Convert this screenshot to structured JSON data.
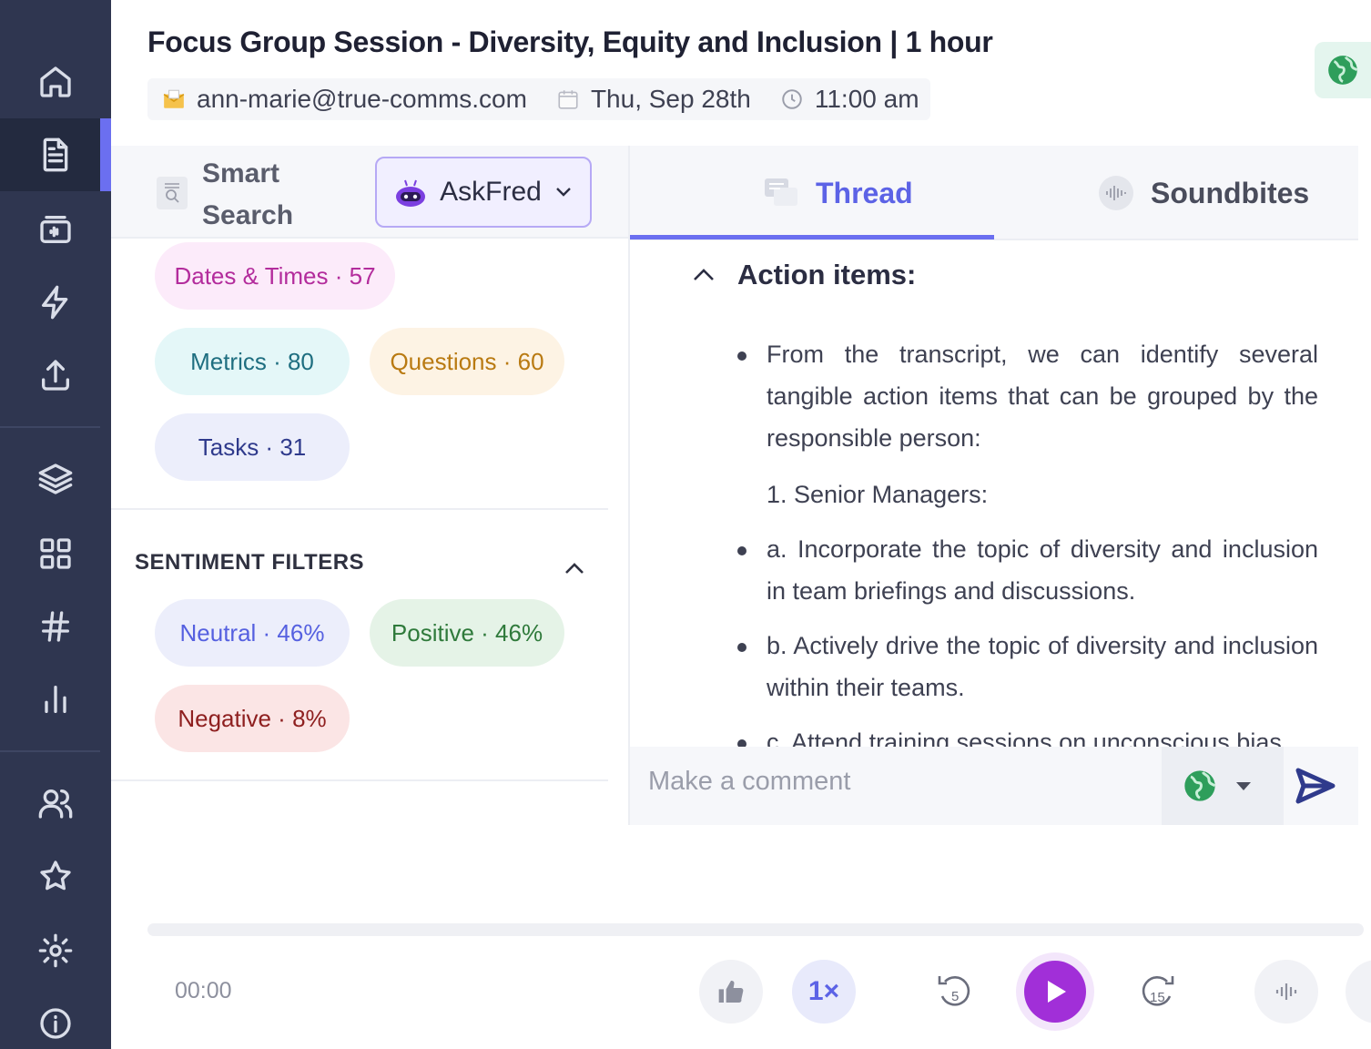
{
  "sidebar": {
    "items": [
      "home",
      "documents",
      "recordings",
      "automations",
      "upload",
      "layers",
      "apps",
      "topics",
      "analytics",
      "people",
      "favorites",
      "settings",
      "info"
    ],
    "active": "documents"
  },
  "header": {
    "title": "Focus Group Session - Diversity, Equity and Inclusion | 1 hour",
    "email": "ann-marie@true-comms.com",
    "date": "Thu, Sep 28th",
    "time": "11:00 am"
  },
  "search": {
    "label": "Smart Search",
    "askfred_label": "AskFred"
  },
  "topic_chips": [
    {
      "label": "Dates & Times · 57"
    },
    {
      "label": "Metrics · 80"
    },
    {
      "label": "Questions · 60"
    },
    {
      "label": "Tasks · 31"
    }
  ],
  "sentiment": {
    "title": "SENTIMENT FILTERS",
    "chips": [
      {
        "label": "Neutral · 46%"
      },
      {
        "label": "Positive · 46%"
      },
      {
        "label": "Negative · 8%"
      }
    ]
  },
  "tabs": [
    {
      "label": "Thread",
      "active": true
    },
    {
      "label": "Soundbites",
      "active": false
    }
  ],
  "thread": {
    "heading": "Action items:",
    "p1": "From the transcript, we can identify several tangible action items that can be grouped by the responsible person:",
    "p2": "1. Senior Managers:",
    "p3": "a. Incorporate the topic of diversity and inclusion in team briefings and discussions.",
    "p4": "b. Actively drive the topic of diversity and inclusion within their teams.",
    "p5": "c. Attend training sessions on unconscious bias"
  },
  "comment": {
    "placeholder": "Make a comment"
  },
  "player": {
    "time": "00:00",
    "speed": "1×",
    "rewind_seconds": "5",
    "forward_seconds": "15",
    "progress": 0
  },
  "colors": {
    "sidebar": "#2f3650",
    "accent": "#6b6ff0",
    "play": "#a12fd8"
  }
}
